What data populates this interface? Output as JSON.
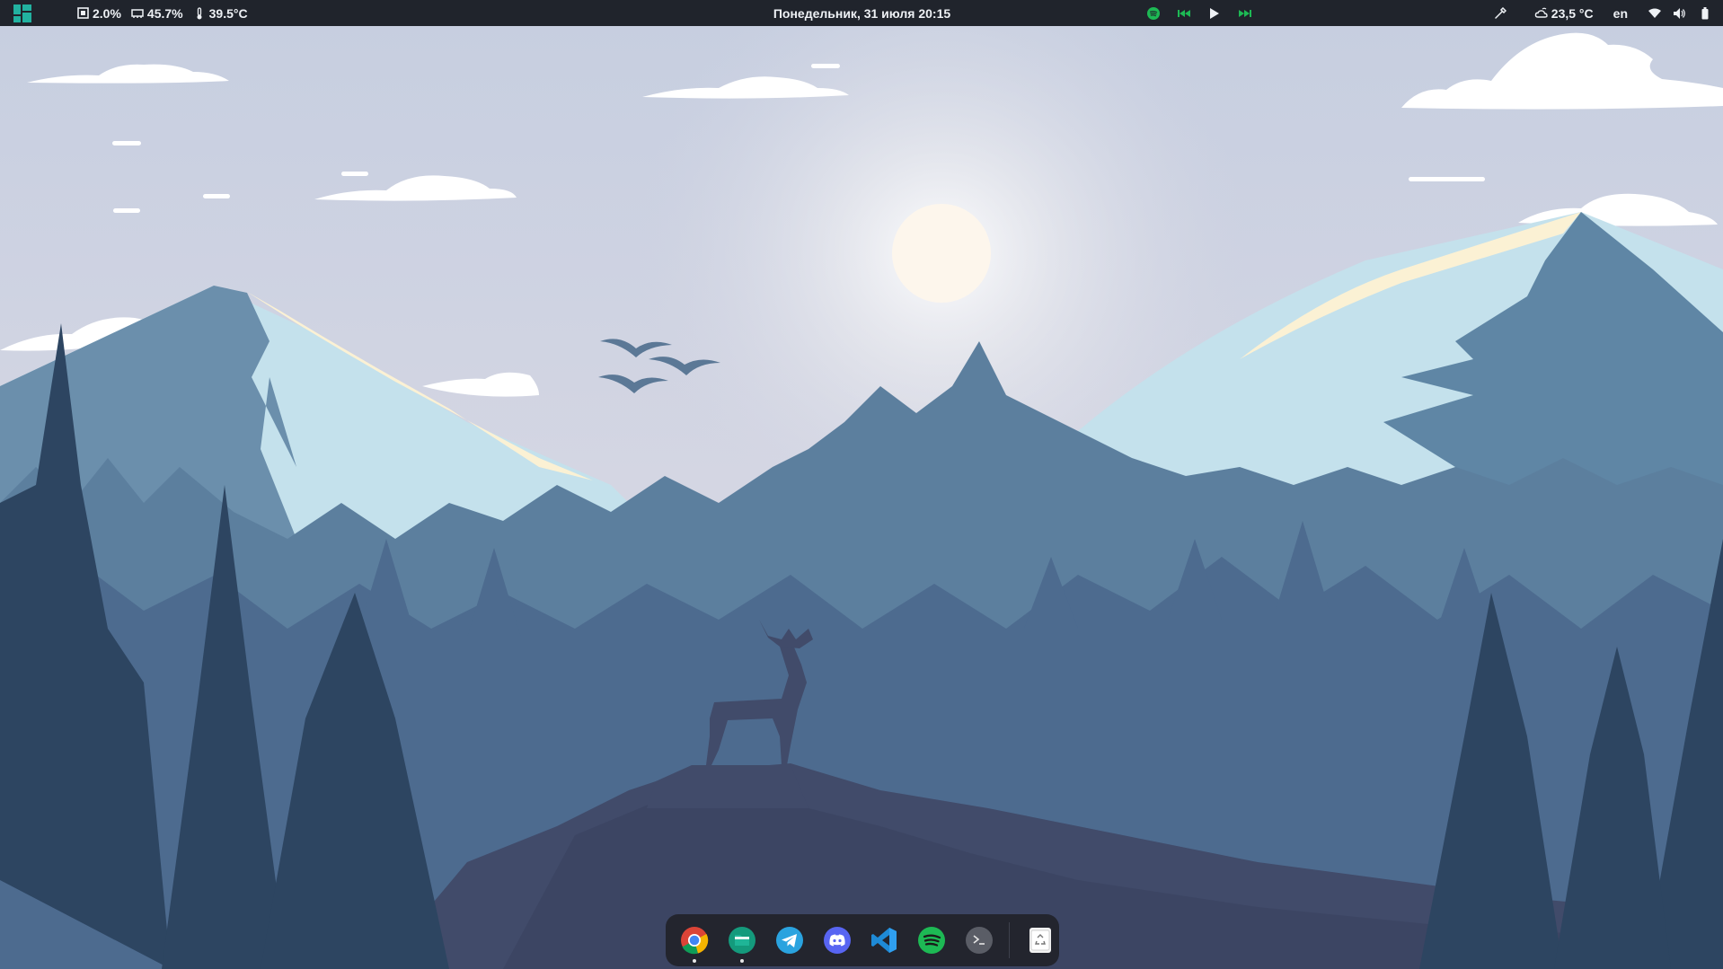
{
  "topbar": {
    "cpu": "2.0%",
    "memory": "45.7%",
    "temperature": "39.5°C",
    "datetime": "Понедельник, 31 июля 20:15",
    "weather": "23,5 °C",
    "keyboard_layout": "en"
  },
  "icons": {
    "apps_menu": "apps-grid-icon",
    "cpu": "cpu-chip-icon",
    "memory": "memory-icon",
    "temperature": "thermometer-icon",
    "spotify": "spotify-icon",
    "previous": "skip-back-icon",
    "play": "play-icon",
    "next": "skip-forward-icon",
    "color_picker": "color-picker-icon",
    "weather": "cloudy-night-icon",
    "wifi": "wifi-icon",
    "volume": "volume-icon",
    "battery": "battery-icon"
  },
  "dock": {
    "apps": [
      "chrome",
      "files",
      "telegram",
      "discord",
      "vscode",
      "spotify",
      "terminal"
    ],
    "trash": "trash"
  },
  "colors": {
    "topbar_bg": "#20242c",
    "dock_bg": "#23252e",
    "accent_green": "#1db954",
    "sky": "#cfd6e3"
  }
}
